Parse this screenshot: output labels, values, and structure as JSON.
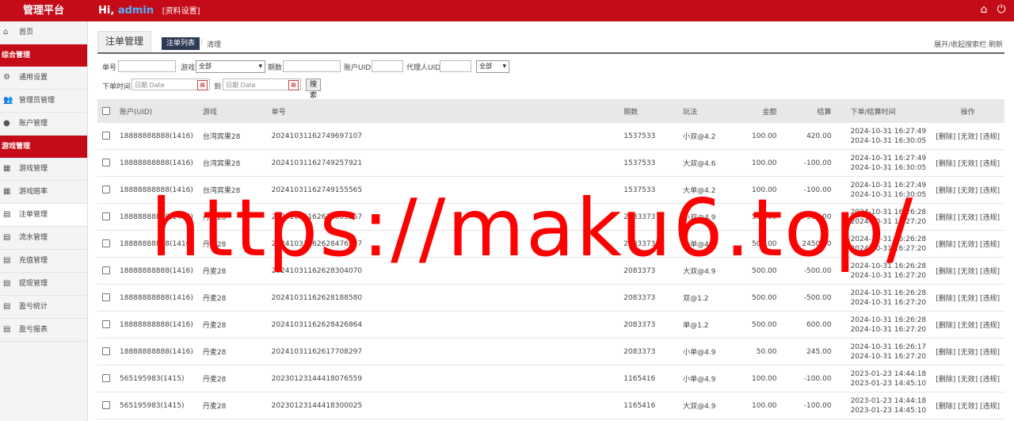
{
  "header": {
    "brand": "管理平台",
    "greeting_prefix": "Hi,",
    "username": "admin",
    "settings_link": "[资料设置]",
    "icons": [
      "home-icon",
      "power-icon"
    ]
  },
  "sidebar": {
    "items": [
      {
        "type": "item",
        "label": "首页",
        "icon": "home-icon"
      },
      {
        "type": "section",
        "label": "综合管理"
      },
      {
        "type": "item",
        "label": "通用设置",
        "icon": "gear-icon"
      },
      {
        "type": "item",
        "label": "管理员管理",
        "icon": "users-icon"
      },
      {
        "type": "item",
        "label": "账户管理",
        "icon": "user-icon"
      },
      {
        "type": "section",
        "label": "游戏管理"
      },
      {
        "type": "item",
        "label": "游戏管理",
        "icon": "grid-icon"
      },
      {
        "type": "item",
        "label": "游戏赔率",
        "icon": "grid-icon"
      },
      {
        "type": "item",
        "label": "注单管理",
        "icon": "list-icon",
        "active": true
      },
      {
        "type": "item",
        "label": "流水管理",
        "icon": "list-icon"
      },
      {
        "type": "item",
        "label": "充值管理",
        "icon": "list-icon"
      },
      {
        "type": "item",
        "label": "提现管理",
        "icon": "list-icon"
      },
      {
        "type": "item",
        "label": "盈亏统计",
        "icon": "list-icon"
      },
      {
        "type": "item",
        "label": "盈亏报表",
        "icon": "list-icon"
      }
    ]
  },
  "tabs": {
    "main": "注单管理",
    "sub": "注单列表",
    "clear": "清理",
    "right": "展开/收起搜索栏 刷新"
  },
  "filters": {
    "order_label": "单号",
    "game_label": "游戏",
    "game_selected": "全部",
    "period_label": "期数",
    "uid_label": "账户UID",
    "agent_label": "代理人UID",
    "agent_selected": "全部",
    "time_label": "下单时间",
    "date_placeholder": "日期 Date",
    "to_label": "到",
    "search_button": "搜索"
  },
  "table": {
    "headers": [
      "账户(UID)",
      "游戏",
      "单号",
      "期数",
      "玩法",
      "金额",
      "结算",
      "下单/结算时间",
      "操作"
    ],
    "rows": [
      {
        "account": "18888888888(1416)",
        "game": "台湾宾果28",
        "order": "20241031162749697107",
        "period": "1537533",
        "play": "小双@4.2",
        "amount": "100.00",
        "settle": "420.00",
        "t1": "2024-10-31 16:27:49",
        "t2": "2024-10-31 16:30:05",
        "ops": "[删除] [无效] [违规]"
      },
      {
        "account": "18888888888(1416)",
        "game": "台湾宾果28",
        "order": "20241031162749257921",
        "period": "1537533",
        "play": "大双@4.6",
        "amount": "100.00",
        "settle": "-100.00",
        "t1": "2024-10-31 16:27:49",
        "t2": "2024-10-31 16:30:05",
        "ops": "[删除] [无效] [违规]"
      },
      {
        "account": "18888888888(1416)",
        "game": "台湾宾果28",
        "order": "20241031162749155565",
        "period": "1537533",
        "play": "大单@4.2",
        "amount": "100.00",
        "settle": "-100.00",
        "t1": "2024-10-31 16:27:49",
        "t2": "2024-10-31 16:30:05",
        "ops": "[删除] [无效] [违规]"
      },
      {
        "account": "18888888888(1416)",
        "game": "丹麦28",
        "order": "20241031162628009367",
        "period": "2083373",
        "play": "小双@4.9",
        "amount": "500.00",
        "settle": "-500.00",
        "t1": "2024-10-31 16:26:28",
        "t2": "2024-10-31 16:27:20",
        "ops": "[删除] [无效] [违规]"
      },
      {
        "account": "18888888888(1416)",
        "game": "丹麦28",
        "order": "20241031162628476597",
        "period": "2083373",
        "play": "小单@4.9",
        "amount": "500.00",
        "settle": "2450.00",
        "t1": "2024-10-31 16:26:28",
        "t2": "2024-10-31 16:27:20",
        "ops": "[删除] [无效] [违规]"
      },
      {
        "account": "18888888888(1416)",
        "game": "丹麦28",
        "order": "20241031162628304070",
        "period": "2083373",
        "play": "大双@4.9",
        "amount": "500.00",
        "settle": "-500.00",
        "t1": "2024-10-31 16:26:28",
        "t2": "2024-10-31 16:27:20",
        "ops": "[删除] [无效] [违规]"
      },
      {
        "account": "18888888888(1416)",
        "game": "丹麦28",
        "order": "20241031162628188580",
        "period": "2083373",
        "play": "双@1.2",
        "amount": "500.00",
        "settle": "-500.00",
        "t1": "2024-10-31 16:26:28",
        "t2": "2024-10-31 16:27:20",
        "ops": "[删除] [无效] [违规]"
      },
      {
        "account": "18888888888(1416)",
        "game": "丹麦28",
        "order": "20241031162628426864",
        "period": "2083373",
        "play": "单@1.2",
        "amount": "500.00",
        "settle": "600.00",
        "t1": "2024-10-31 16:26:28",
        "t2": "2024-10-31 16:27:20",
        "ops": "[删除] [无效] [违规]"
      },
      {
        "account": "18888888888(1416)",
        "game": "丹麦28",
        "order": "20241031162617708297",
        "period": "2083373",
        "play": "小单@4.9",
        "amount": "50.00",
        "settle": "245.00",
        "t1": "2024-10-31 16:26:17",
        "t2": "2024-10-31 16:27:20",
        "ops": "[删除] [无效] [违规]"
      },
      {
        "account": "565195983(1415)",
        "game": "丹麦28",
        "order": "20230123144418076559",
        "period": "1165416",
        "play": "小单@4.9",
        "amount": "100.00",
        "settle": "-100.00",
        "t1": "2023-01-23 14:44:18",
        "t2": "2023-01-23 14:45:10",
        "ops": "[删除] [无效] [违规]"
      },
      {
        "account": "565195983(1415)",
        "game": "丹麦28",
        "order": "20230123144418300025",
        "period": "1165416",
        "play": "大双@4.9",
        "amount": "100.00",
        "settle": "-100.00",
        "t1": "2023-01-23 14:44:18",
        "t2": "2023-01-23 14:45:10",
        "ops": "[删除] [无效] [违规]"
      }
    ]
  },
  "watermark": "https://maku6.top/"
}
